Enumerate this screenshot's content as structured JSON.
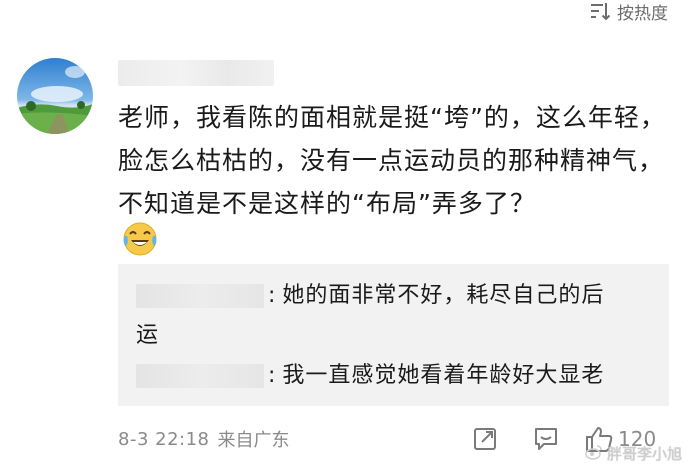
{
  "sort": {
    "label": "按热度",
    "icon": "sort-icon"
  },
  "comment": {
    "text": "老师，我看陈的面相就是挺“垮”的，这么年轻，脸怎么枯枯的，没有一点运动员的那种精神气，不知道是不是这样的“布局”弄多了？",
    "emoji": "laugh-cry-emoji"
  },
  "replies": [
    {
      "prefix": ":",
      "text": "她的面非常不好，耗尽自己的后",
      "cont": "运"
    },
    {
      "prefix": ":",
      "text": "我一直感觉她看着年龄好大显老"
    }
  ],
  "footer": {
    "time": "8-3 22:18",
    "source": "来自广东",
    "share_icon": "share-icon",
    "comment_icon": "comment-icon",
    "like_icon": "thumbs-up-icon",
    "like_count": "120"
  },
  "watermark": {
    "text": "胖哥李小旭"
  },
  "colors": {
    "muted": "#8a8a8a",
    "reply_bg": "#f2f2f2"
  }
}
